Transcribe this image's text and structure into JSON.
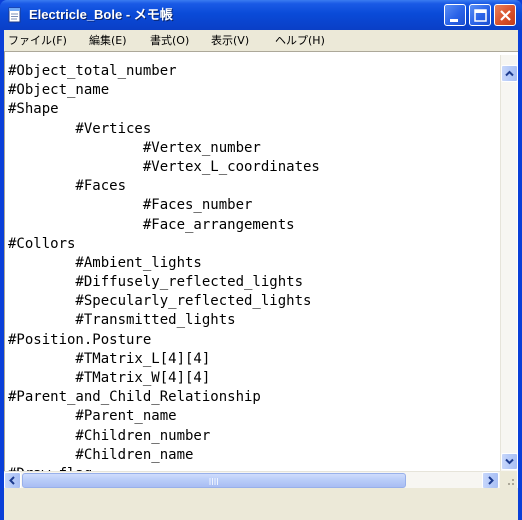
{
  "window": {
    "title": "Electricle_Bole - メモ帳"
  },
  "menubar": {
    "items": [
      {
        "label": "ファイル(F)"
      },
      {
        "label": "編集(E)"
      },
      {
        "label": "書式(O)"
      },
      {
        "label": "表示(V)"
      },
      {
        "label": "ヘルプ(H)"
      }
    ]
  },
  "editor": {
    "lines": [
      "#Object_total_number",
      "#Object_name",
      "#Shape",
      "        #Vertices",
      "                #Vertex_number",
      "                #Vertex_L_coordinates",
      "        #Faces",
      "                #Faces_number",
      "                #Face_arrangements",
      "#Collors",
      "        #Ambient_lights",
      "        #Diffusely_reflected_lights",
      "        #Specularly_reflected_lights",
      "        #Transmitted_lights",
      "#Position.Posture",
      "        #TMatrix_L[4][4]",
      "        #TMatrix_W[4][4]",
      "#Parent_and_Child_Relationship",
      "        #Parent_name",
      "        #Children_number",
      "        #Children_name",
      "#Draw_flag"
    ]
  },
  "colors": {
    "titlebar": "#0a4bd8",
    "frame": "#ece9d8",
    "close_button": "#d8512c"
  },
  "icons": {
    "app": "notepad-icon",
    "minimize": "minimize-icon",
    "maximize": "maximize-icon",
    "close": "close-icon"
  }
}
